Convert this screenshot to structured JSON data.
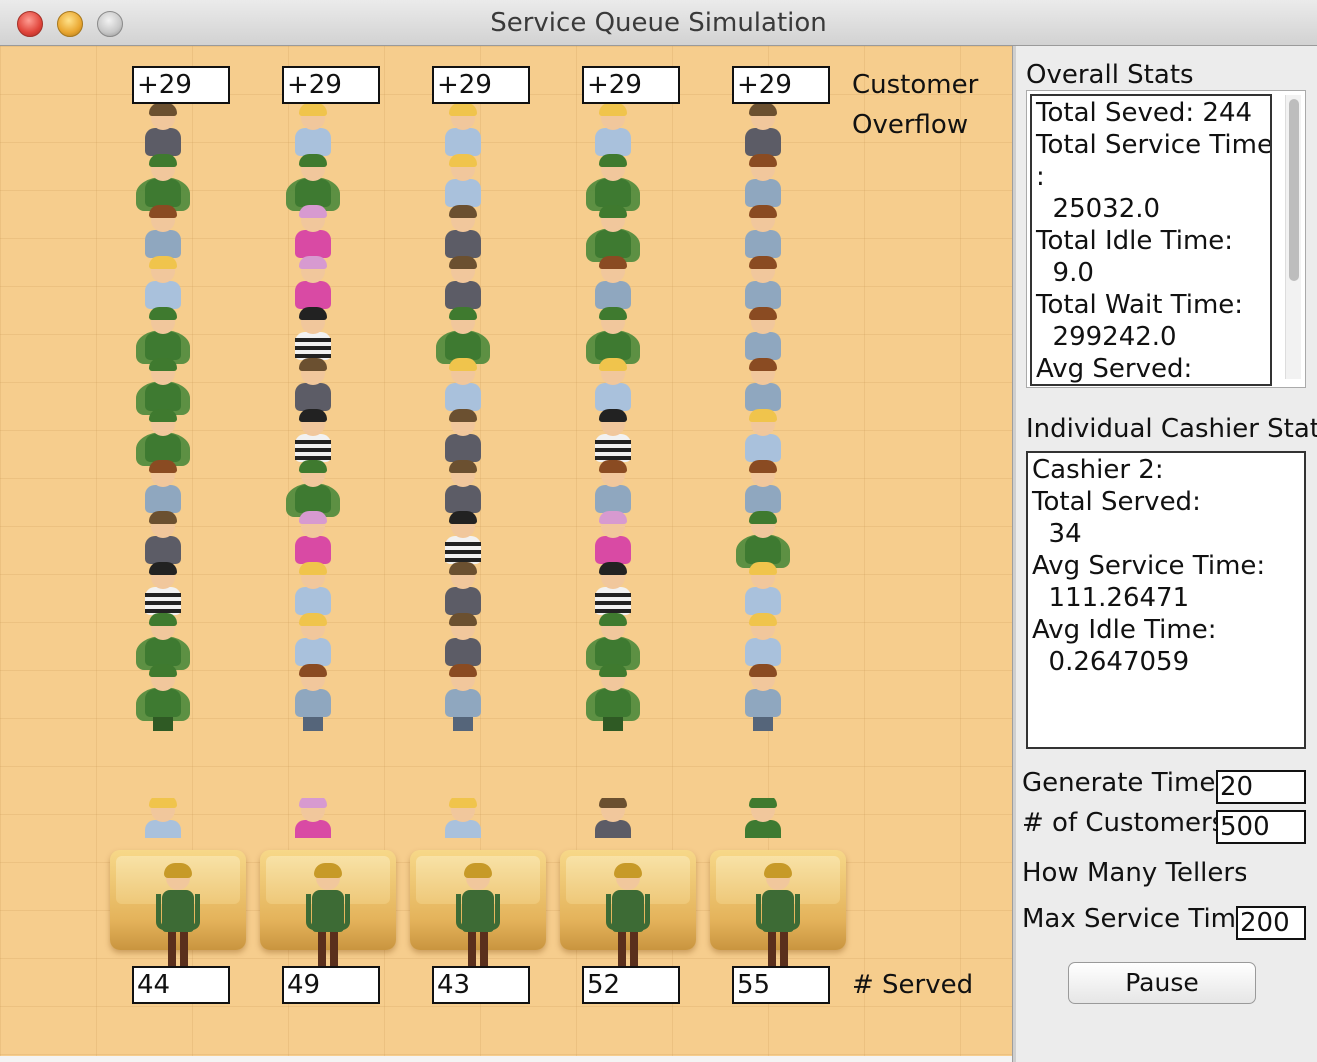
{
  "window": {
    "title": "Service Queue Simulation"
  },
  "simulation": {
    "overflow_counts": [
      "+29",
      "+29",
      "+29",
      "+29",
      "+29"
    ],
    "overflow_label_line1": "Customer",
    "overflow_label_line2": "Overflow",
    "served_counts": [
      "44",
      "49",
      "43",
      "52",
      "55"
    ],
    "served_label": "# Served",
    "background_color": "#f6cd8d"
  },
  "overall_stats": {
    "title": "Overall Stats",
    "lines": [
      "Total Seved: 244",
      "Total Service Time",
      ":",
      "  25032.0",
      "Total Idle Time:",
      "  9.0",
      "Total Wait Time:",
      "  299242.0",
      "Avg Served:"
    ]
  },
  "cashier_stats": {
    "title": "Individual Cashier Stats",
    "lines": [
      "Cashier 2:",
      "Total Served:",
      "  34",
      "Avg Service Time:",
      "  111.26471",
      "Avg Idle Time:",
      "  0.2647059"
    ]
  },
  "controls": {
    "generate_time_label": "Generate Time:",
    "generate_time_value": "20",
    "customers_label": "# of Customers",
    "customers_value": "500",
    "tellers_label": "How Many Tellers'",
    "max_service_label": "Max Service Time",
    "max_service_value": "200",
    "pause_label": "Pause"
  }
}
